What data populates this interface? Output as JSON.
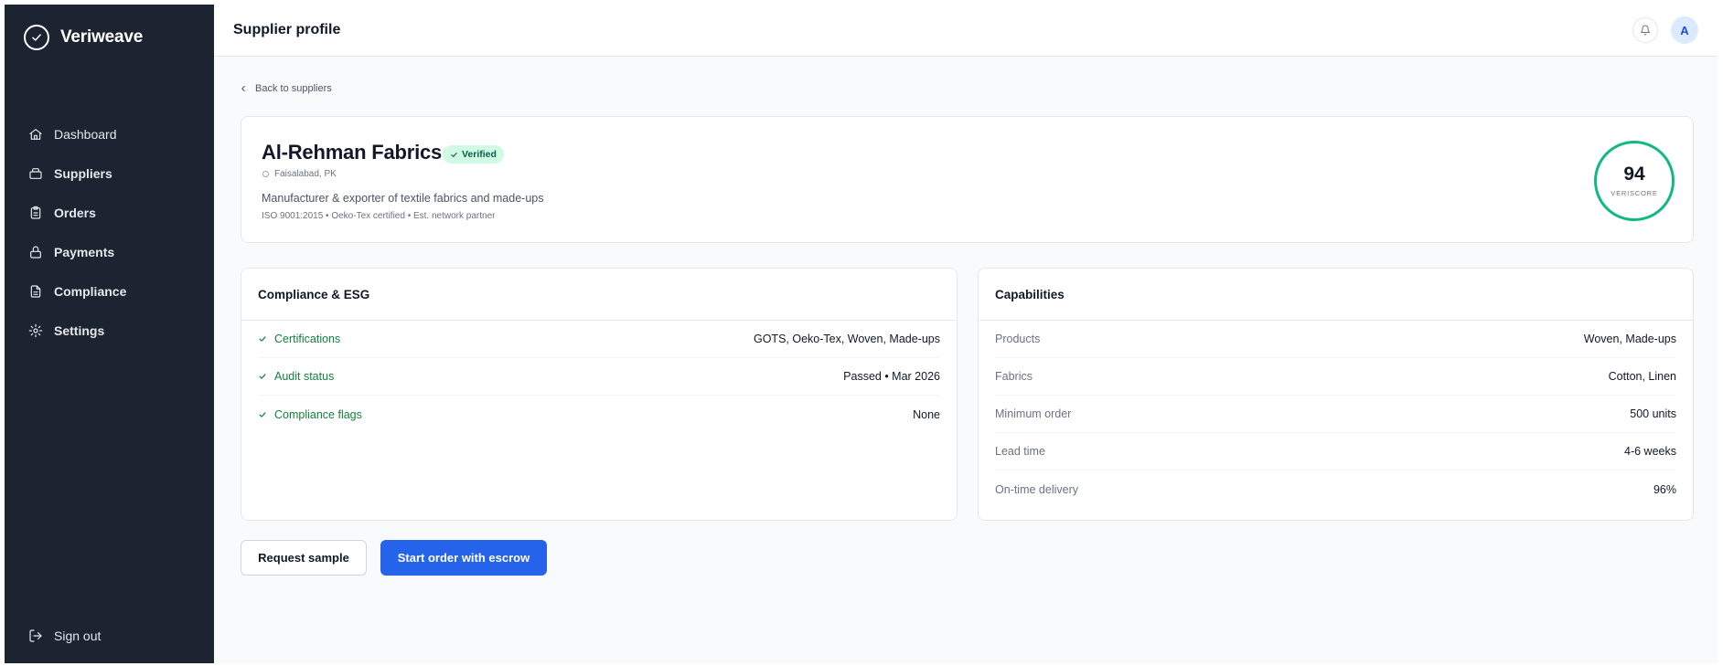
{
  "app": {
    "name": "Veriweave"
  },
  "sidebar": {
    "items": [
      {
        "label": "Dashboard",
        "icon": "home-icon"
      },
      {
        "label": "Suppliers",
        "icon": "building-icon"
      },
      {
        "label": "Orders",
        "icon": "clipboard-icon"
      },
      {
        "label": "Payments",
        "icon": "lock-icon"
      },
      {
        "label": "Compliance",
        "icon": "file-icon"
      },
      {
        "label": "Settings",
        "icon": "gear-icon"
      }
    ],
    "sign_out": "Sign out"
  },
  "header": {
    "title": "Supplier profile",
    "avatar_initial": "A"
  },
  "back_link": "Back to suppliers",
  "supplier": {
    "name": "Al-Rehman Fabrics",
    "badge": "Verified",
    "location": "Faisalabad, PK",
    "description": "Manufacturer & exporter of textile fabrics and made-ups",
    "certs_line": "ISO 9001:2015 • Oeko-Tex certified • Est. network partner",
    "score": "94",
    "score_label": "VERISCORE"
  },
  "compliance": {
    "title": "Compliance & ESG",
    "rows": [
      {
        "label": "Certifications",
        "value": "GOTS, Oeko-Tex, Woven, Made-ups"
      },
      {
        "label": "Audit status",
        "value": "Passed • Mar 2026"
      },
      {
        "label": "Compliance flags",
        "value": "None"
      }
    ]
  },
  "capabilities": {
    "title": "Capabilities",
    "rows": [
      {
        "label": "Products",
        "value": "Woven, Made-ups"
      },
      {
        "label": "Fabrics",
        "value": "Cotton, Linen"
      },
      {
        "label": "Minimum order",
        "value": "500 units"
      },
      {
        "label": "Lead time",
        "value": "4-6 weeks"
      },
      {
        "label": "On-time delivery",
        "value": "96%"
      }
    ]
  },
  "actions": {
    "request_sample": "Request sample",
    "start_order": "Start order with escrow"
  },
  "colors": {
    "sidebar_bg": "#1b2430",
    "primary": "#2563eb",
    "success": "#10b981",
    "verified_bg": "#d1fae5"
  }
}
